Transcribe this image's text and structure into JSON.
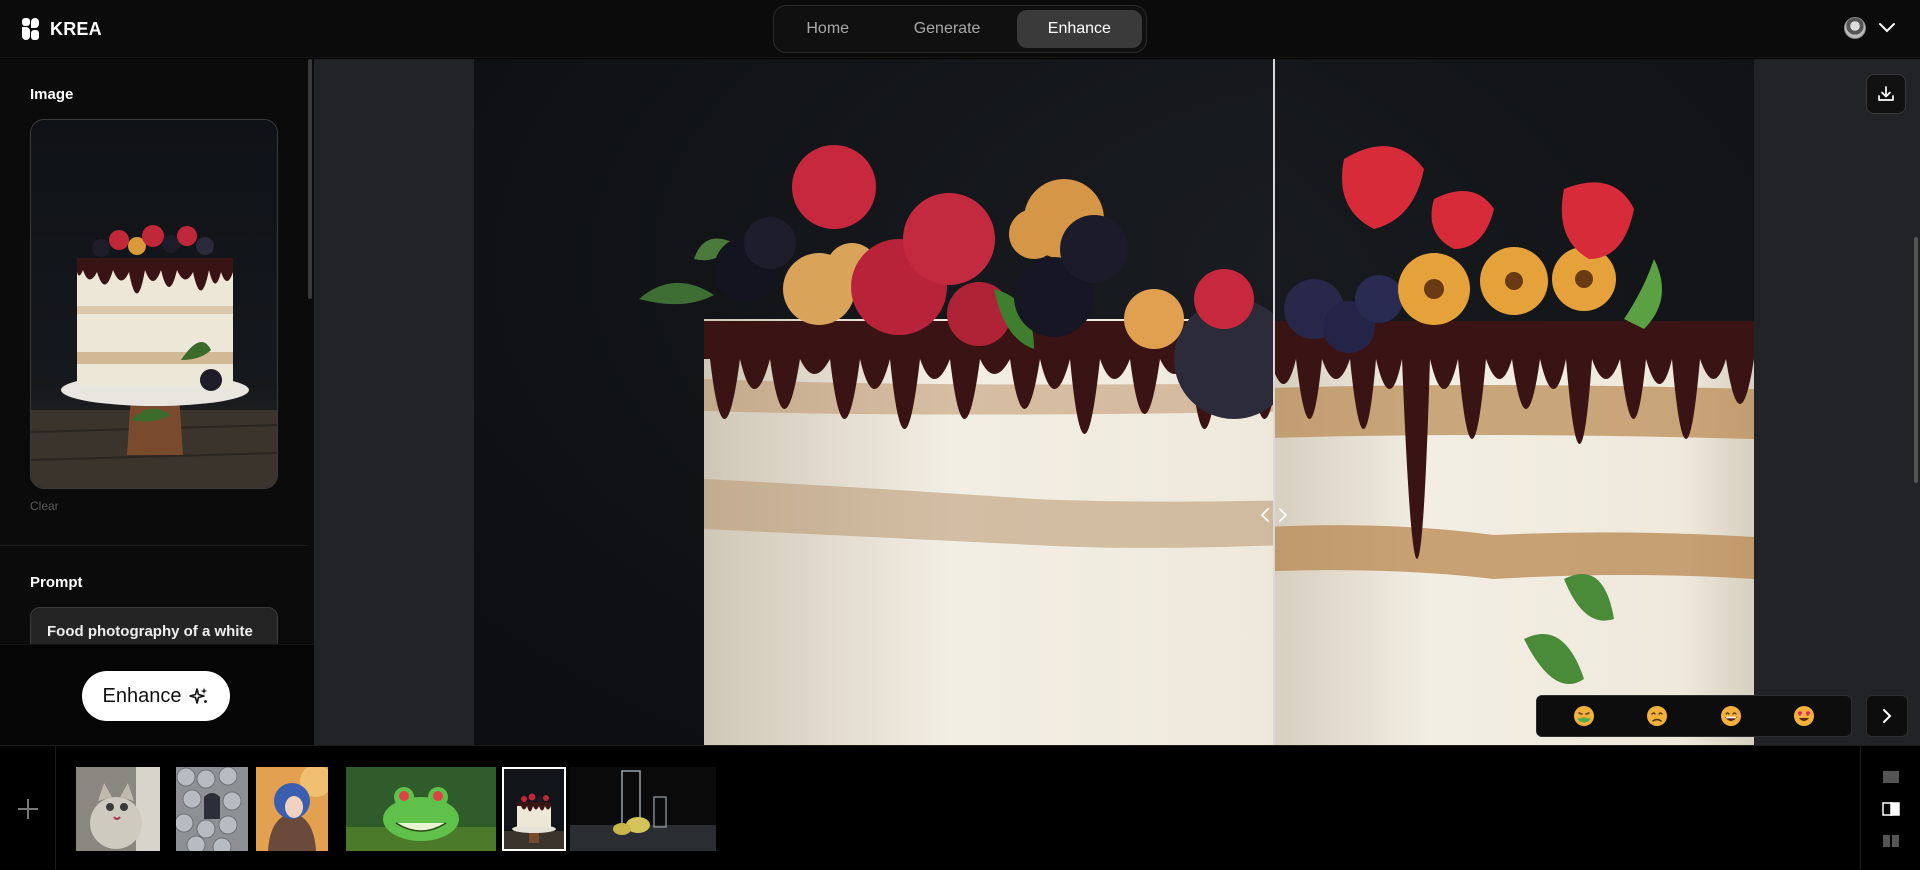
{
  "app": {
    "brand": "KREA"
  },
  "nav": {
    "tabs": [
      {
        "label": "Home",
        "active": false
      },
      {
        "label": "Generate",
        "active": false
      },
      {
        "label": "Enhance",
        "active": true
      }
    ]
  },
  "sidebar": {
    "image_heading": "Image",
    "clear_label": "Clear",
    "prompt_heading": "Prompt",
    "prompt_text": "Food photography of a white cake with fruits on top, dark",
    "enhance_label": "Enhance"
  },
  "canvas": {
    "rating_faces": [
      "nauseated-face-icon",
      "disappointed-face-icon",
      "grinning-face-icon",
      "heart-eyes-face-icon"
    ]
  },
  "history": {
    "items": [
      "kitten",
      "hooded-figure-tiles",
      "anime-portrait",
      "frog",
      "cake",
      "glass-and-lemons"
    ],
    "selected_index": 4
  },
  "colors": {
    "accent_active_tab": "#3a3a3a",
    "cta_background": "#ffffff",
    "chocolate": "#3a1414",
    "cream": "#efe9dc"
  }
}
